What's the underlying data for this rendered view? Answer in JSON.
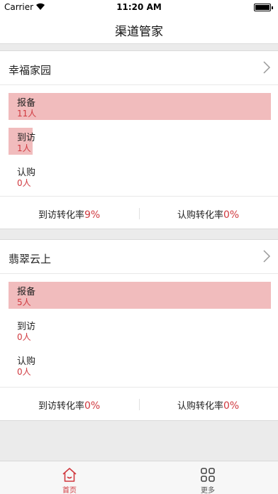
{
  "status_bar": {
    "carrier": "Carrier",
    "time": "11:20 AM"
  },
  "nav": {
    "title": "渠道管家"
  },
  "projects": [
    {
      "name": "幸福家园",
      "rows": [
        {
          "label": "报备",
          "count": "11人",
          "fill": 1.0
        },
        {
          "label": "到访",
          "count": "1人",
          "fill": 0.09
        },
        {
          "label": "认购",
          "count": "0人",
          "fill": 0.0
        }
      ],
      "visit_rate_label": "到访转化率",
      "visit_rate": "9%",
      "purchase_rate_label": "认购转化率",
      "purchase_rate": "0%"
    },
    {
      "name": "翡翠云上",
      "rows": [
        {
          "label": "报备",
          "count": "5人",
          "fill": 1.0
        },
        {
          "label": "到访",
          "count": "0人",
          "fill": 0.0
        },
        {
          "label": "认购",
          "count": "0人",
          "fill": 0.0
        }
      ],
      "visit_rate_label": "到访转化率",
      "visit_rate": "0%",
      "purchase_rate_label": "认购转化率",
      "purchase_rate": "0%"
    }
  ],
  "tabbar": {
    "home_label": "首页",
    "more_label": "更多"
  },
  "colors": {
    "accent": "#d0393f",
    "bar_fill": "#f1bcbd"
  }
}
